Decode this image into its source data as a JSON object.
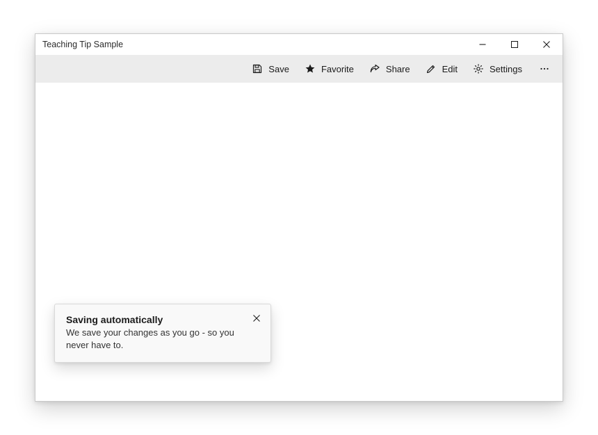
{
  "window": {
    "title": "Teaching Tip Sample"
  },
  "commandbar": {
    "save": "Save",
    "favorite": "Favorite",
    "share": "Share",
    "edit": "Edit",
    "settings": "Settings"
  },
  "teachingTip": {
    "title": "Saving automatically",
    "subtitle": "We save your changes as you go - so you never have to."
  }
}
